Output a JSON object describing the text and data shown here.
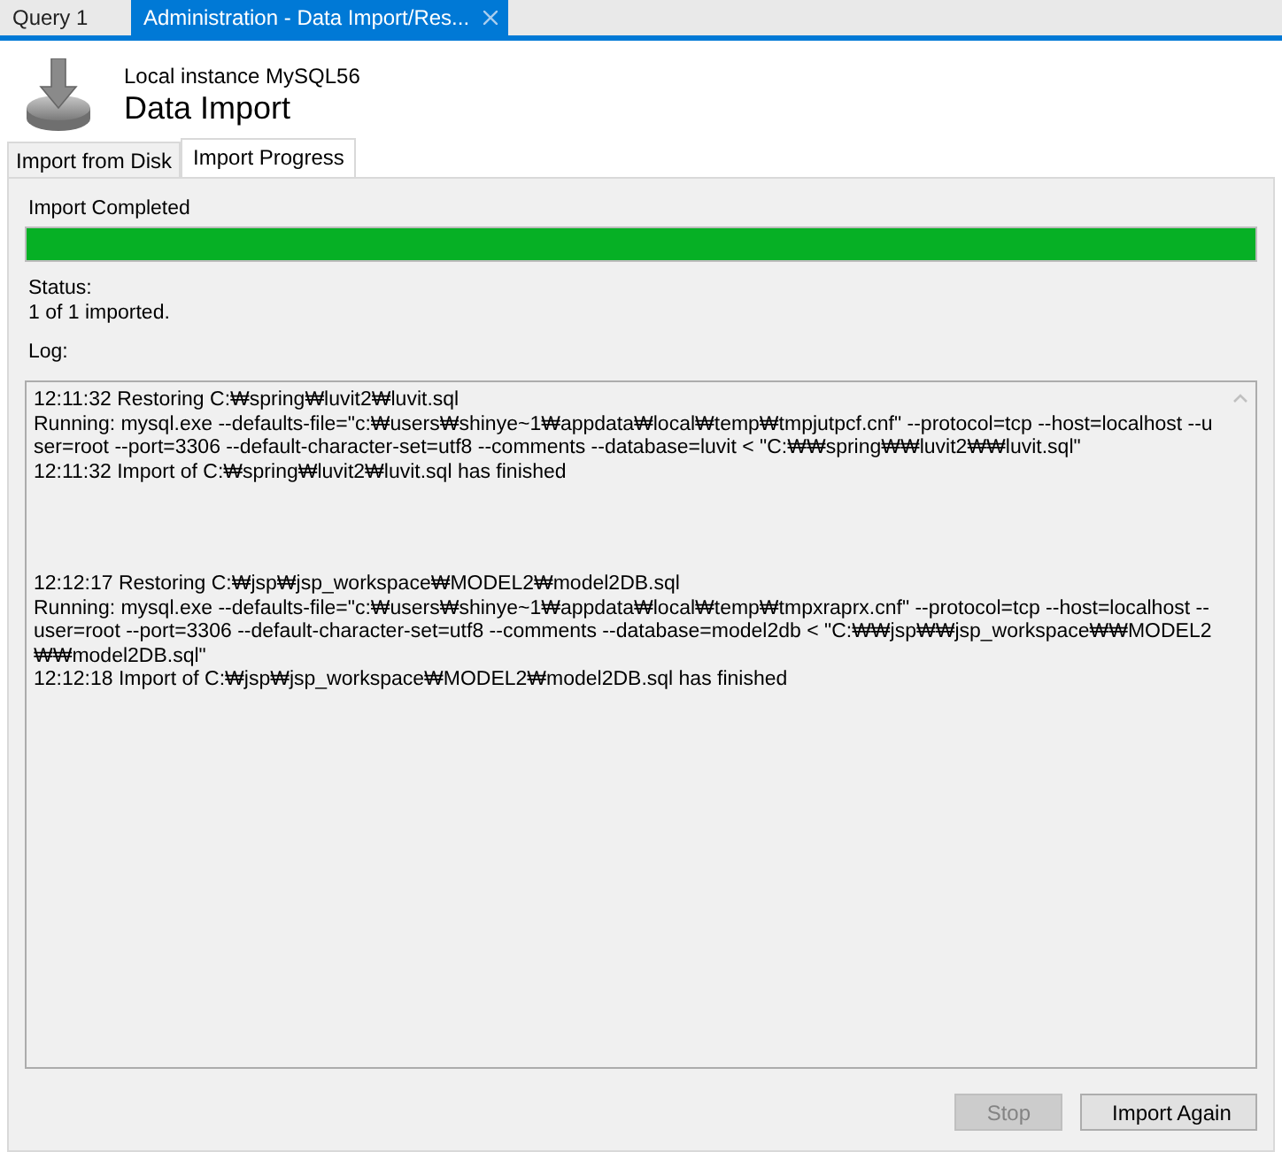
{
  "doc_tabs": [
    {
      "label": "Query 1",
      "selected": false,
      "closable": false
    },
    {
      "label": "Administration - Data Import/Res...",
      "selected": true,
      "closable": true
    }
  ],
  "header": {
    "subtitle": "Local instance MySQL56",
    "title": "Data Import"
  },
  "tabs": [
    {
      "label": "Import from Disk",
      "selected": false
    },
    {
      "label": "Import Progress",
      "selected": true
    }
  ],
  "progress": {
    "label": "Import Completed",
    "level": 1
  },
  "status": {
    "label": "Status:",
    "value": "1 of 1 imported."
  },
  "log": {
    "label": "Log:",
    "groups": [
      {
        "lines": [
          "12:11:32 Restoring C:₩spring₩luvit2₩luvit.sql",
          "Running: mysql.exe --defaults-file=\"c:₩users₩shinye~1₩appdata₩local₩temp₩tmpjutpcf.cnf\"  --protocol=tcp --host=localhost --user=root --port=3306 --default-character-set=utf8 --comments --database=luvit  < \"C:₩₩spring₩₩luvit2₩₩luvit.sql\"",
          "12:11:32 Import of C:₩spring₩luvit2₩luvit.sql has finished"
        ]
      },
      {
        "lines": [
          "12:12:17 Restoring C:₩jsp₩jsp_workspace₩MODEL2₩model2DB.sql",
          "Running: mysql.exe --defaults-file=\"c:₩users₩shinye~1₩appdata₩local₩temp₩tmpxraprx.cnf\"  --protocol=tcp --host=localhost --user=root --port=3306 --default-character-set=utf8 --comments --database=model2db  < \"C:₩₩jsp₩₩jsp_workspace₩₩MODEL2₩₩model2DB.sql\"",
          "12:12:18 Import of C:₩jsp₩jsp_workspace₩MODEL2₩model2DB.sql has finished"
        ]
      }
    ]
  },
  "buttons": [
    {
      "label": "Stop",
      "disabled": true
    },
    {
      "label": "Import Again",
      "disabled": false
    }
  ]
}
